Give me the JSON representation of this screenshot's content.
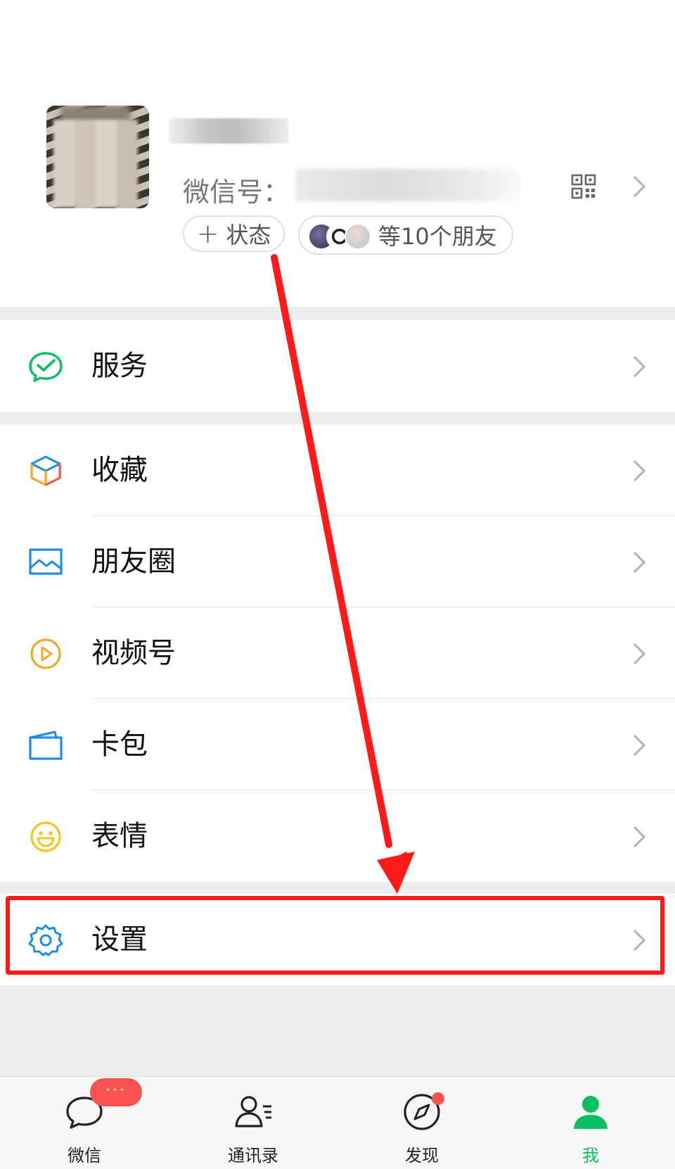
{
  "profile": {
    "wechat_id_label": "微信号：",
    "status_label": "状态",
    "status_plus": "+",
    "friends_label": "等10个朋友"
  },
  "menu_groups": [
    {
      "items": [
        {
          "label": "服务",
          "icon": "wechat-pay-service-icon",
          "color": "#07c160"
        }
      ]
    },
    {
      "items": [
        {
          "label": "收藏",
          "icon": "favorites-cube-icon",
          "color": "#f5a623"
        },
        {
          "label": "朋友圈",
          "icon": "moments-picture-icon",
          "color": "#1f8ce6"
        },
        {
          "label": "视频号",
          "icon": "channels-play-icon",
          "color": "#f5a623"
        },
        {
          "label": "卡包",
          "icon": "card-wallet-icon",
          "color": "#1f8ce6"
        },
        {
          "label": "表情",
          "icon": "sticker-smile-icon",
          "color": "#f7c31b"
        }
      ]
    },
    {
      "items": [
        {
          "label": "设置",
          "icon": "gear-icon",
          "color": "#1f8ce6"
        }
      ]
    }
  ],
  "tabbar": {
    "tabs": [
      {
        "label": "微信",
        "icon": "chat-bubble-icon"
      },
      {
        "label": "通讯录",
        "icon": "contacts-icon"
      },
      {
        "label": "发现",
        "icon": "compass-icon"
      },
      {
        "label": "我",
        "icon": "person-icon",
        "active": true
      }
    ],
    "chat_badge": "···"
  },
  "annotation": {
    "highlight_color": "#ff1a1a"
  },
  "colors": {
    "accent": "#07c160",
    "badge": "#fa5151"
  }
}
